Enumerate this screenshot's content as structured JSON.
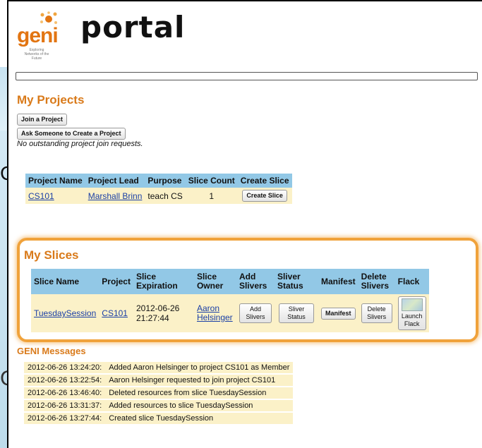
{
  "app": {
    "logo_word": "geni",
    "logo_tagline": "Exploring Networks of the Future",
    "title": "portal"
  },
  "background": {
    "text_left_1": "Cr",
    "text_left_2": "C"
  },
  "colors": {
    "accent": "#d97a1a",
    "header_bg": "#92c8e6",
    "row_bg": "#fbf1c8",
    "highlight": "#f0a23b",
    "link": "#1a3fa6"
  },
  "projects": {
    "heading": "My Projects",
    "join_button": "Join a Project",
    "ask_button": "Ask Someone to Create a Project",
    "note": "No outstanding project join requests.",
    "columns": [
      "Project Name",
      "Project Lead",
      "Purpose",
      "Slice Count",
      "Create Slice"
    ],
    "rows": [
      {
        "name": "CS101",
        "lead": "Marshall Brinn",
        "purpose": "teach CS",
        "count": "1",
        "create_label": "Create Slice"
      }
    ]
  },
  "slices": {
    "heading": "My Slices",
    "columns": [
      "Slice Name",
      "Project",
      "Slice Expiration",
      "Slice Owner",
      "Add Slivers",
      "Sliver Status",
      "Manifest",
      "Delete Slivers",
      "Flack"
    ],
    "rows": [
      {
        "name": "TuesdaySession",
        "project": "CS101",
        "expiration_date": "2012-06-26",
        "expiration_time": "21:27:44",
        "owner_first": "Aaron",
        "owner_last": "Helsinger",
        "add_label": "Add Slivers",
        "status_label": "Sliver Status",
        "manifest_label": "Manifest",
        "delete_label": "Delete Slivers",
        "flack_label": "Launch Flack"
      }
    ]
  },
  "messages": {
    "heading": "GENI Messages",
    "rows": [
      {
        "time": "2012-06-26 13:24:20:",
        "text": "Added Aaron Helsinger to project CS101 as Member"
      },
      {
        "time": "2012-06-26 13:22:54:",
        "text": "Aaron Helsinger requested to join project CS101"
      },
      {
        "time": "2012-06-26 13:46:40:",
        "text": "Deleted resources from slice TuesdaySession"
      },
      {
        "time": "2012-06-26 13:31:37:",
        "text": "Added resources to slice TuesdaySession"
      },
      {
        "time": "2012-06-26 13:27:44:",
        "text": "Created slice TuesdaySession"
      }
    ]
  }
}
